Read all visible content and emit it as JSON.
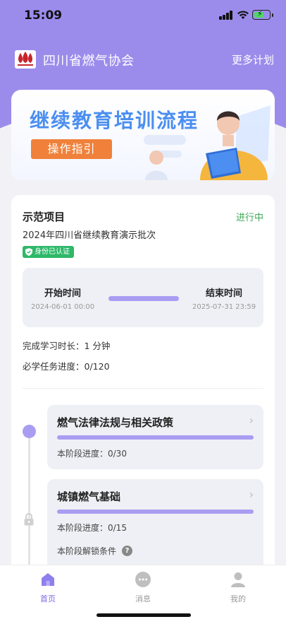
{
  "status_bar": {
    "time": "15:09"
  },
  "header": {
    "title": "四川省燃气协会",
    "more_link": "更多计划"
  },
  "banner": {
    "title": "继续教育培训流程",
    "button": "操作指引"
  },
  "project": {
    "title": "示范项目",
    "status": "进行中",
    "batch": "2024年四川省继续教育演示批次",
    "verified_badge": "身份已认证",
    "start_label": "开始时间",
    "start_value": "2024-06-01 00:00",
    "end_label": "结束时间",
    "end_value": "2025-07-31 23:59",
    "study_duration": "完成学习时长：1 分钟",
    "required_progress": "必学任务进度：0/120"
  },
  "stages": [
    {
      "title": "燃气法律法规与相关政策",
      "progress": "本阶段进度：0/30",
      "progress_fraction": 0.0
    },
    {
      "title": "城镇燃气基础",
      "progress": "本阶段进度：0/15",
      "progress_fraction": 0.0,
      "unlock_label": "本阶段解锁条件"
    }
  ],
  "tabs": [
    {
      "label": "首页",
      "icon": "home-icon",
      "active": true
    },
    {
      "label": "消息",
      "icon": "message-icon",
      "active": false
    },
    {
      "label": "我的",
      "icon": "profile-icon",
      "active": false
    }
  ],
  "colors": {
    "accent": "#9b8cec",
    "progress": "#a99df2",
    "status_green": "#3dab5a",
    "banner_button": "#f0813a",
    "banner_title": "#4b8ef0"
  }
}
